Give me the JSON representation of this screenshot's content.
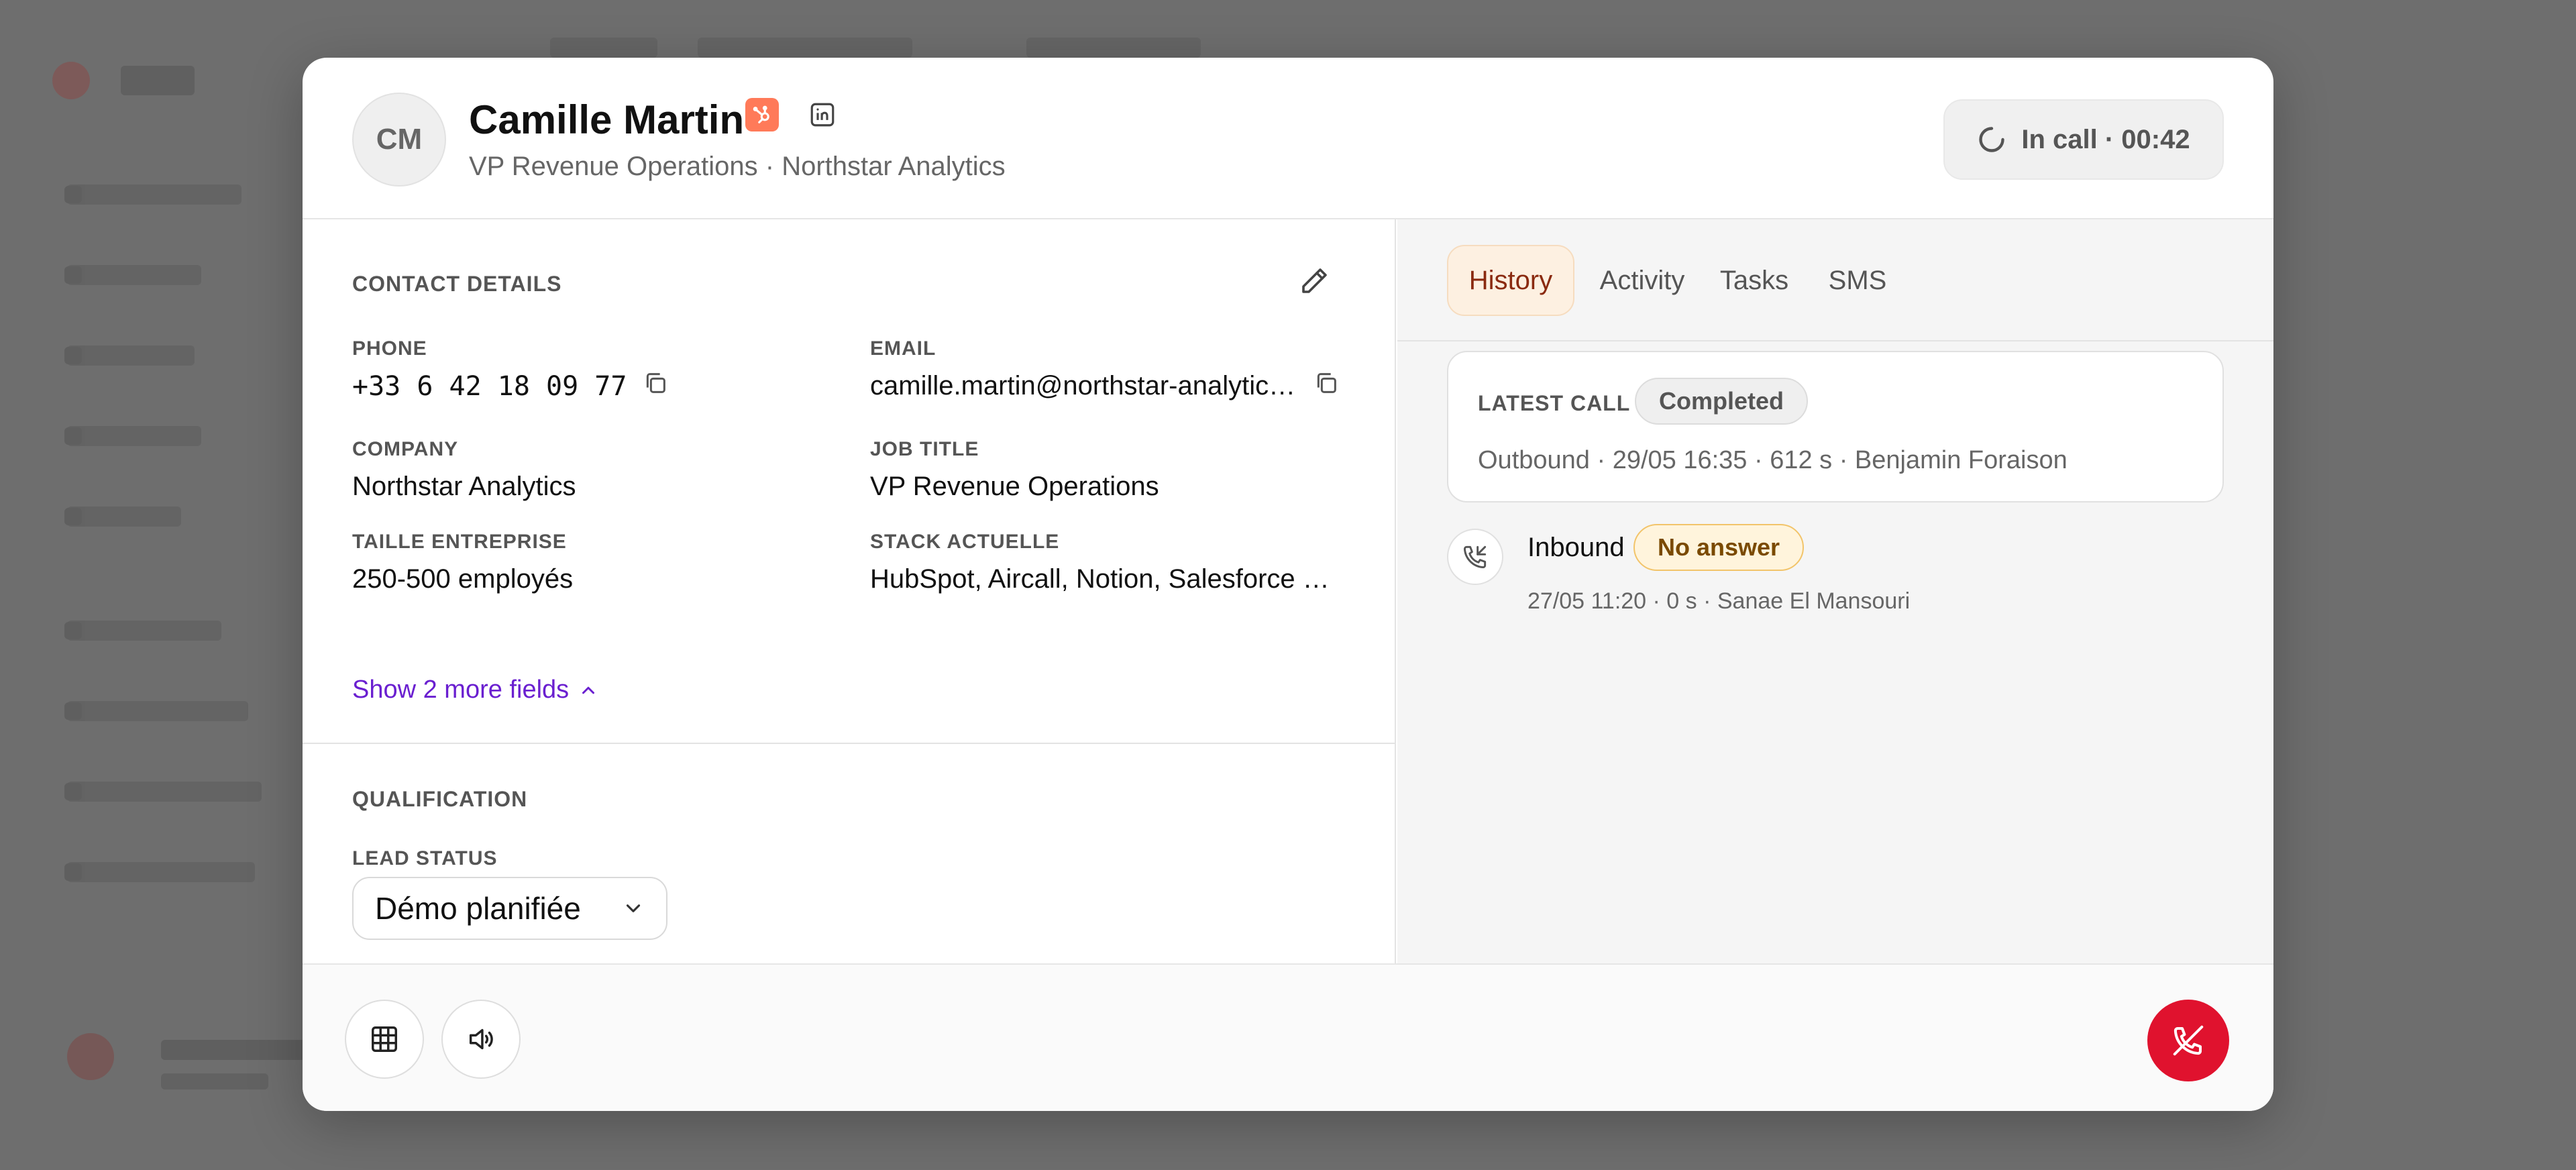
{
  "contact": {
    "initials": "CM",
    "name": "Camille Martin",
    "subtitle": "VP Revenue Operations · Northstar Analytics"
  },
  "call_status": {
    "label": "In call · 00:42"
  },
  "contact_details": {
    "section_title": "CONTACT DETAILS",
    "fields": {
      "phone_label": "PHONE",
      "phone_value": "+33 6 42 18 09 77",
      "email_label": "EMAIL",
      "email_value": "camille.martin@northstar-analytic…",
      "company_label": "COMPANY",
      "company_value": "Northstar Analytics",
      "job_title_label": "JOB TITLE",
      "job_title_value": "VP Revenue Operations",
      "company_size_label": "TAILLE ENTREPRISE",
      "company_size_value": "250-500 employés",
      "stack_label": "STACK ACTUELLE",
      "stack_value": "HubSpot, Aircall, Notion, Salesforce e…"
    },
    "show_more": "Show 2 more fields"
  },
  "qualification": {
    "section_title": "QUALIFICATION",
    "lead_status_label": "LEAD STATUS",
    "lead_status_value": "Démo planifiée"
  },
  "tabs": [
    {
      "label": "History",
      "active": true
    },
    {
      "label": "Activity",
      "active": false
    },
    {
      "label": "Tasks",
      "active": false
    },
    {
      "label": "SMS",
      "active": false
    }
  ],
  "history": {
    "latest_call": {
      "label": "LATEST CALL",
      "status": "Completed",
      "detail": "Outbound · 29/05 16:35 · 612 s · Benjamin Foraison"
    },
    "calls": [
      {
        "type": "Inbound",
        "status": "No answer",
        "meta": "27/05 11:20 · 0 s · Sanae El Mansouri"
      }
    ]
  },
  "colors": {
    "accent_purple": "#6a1fd0",
    "hangup_red": "#e0122e",
    "hubspot_orange": "#ff7a59",
    "active_tab_bg": "#fdf0e1",
    "no_answer_bg": "#fff4dc"
  },
  "icons": {
    "hubspot": "hubspot-icon",
    "linkedin": "linkedin-icon",
    "spinner": "spinner-icon",
    "edit": "pencil-icon",
    "copy": "copy-icon",
    "chevron_up": "chevron-up-icon",
    "chevron_down": "chevron-down-icon",
    "inbound_call": "phone-incoming-icon",
    "keypad": "keypad-icon",
    "speaker": "speaker-icon",
    "hangup": "phone-hangup-icon"
  }
}
